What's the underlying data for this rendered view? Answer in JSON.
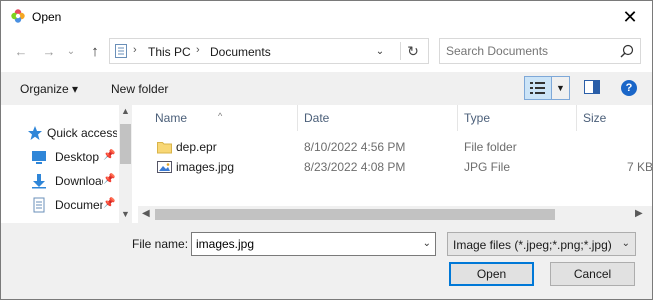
{
  "window": {
    "title": "Open",
    "close_glyph": "✕"
  },
  "nav": {
    "back_glyph": "←",
    "forward_glyph": "→",
    "recent_glyph": "⌄",
    "up_glyph": "↑"
  },
  "address": {
    "segments": [
      "This PC",
      "Documents"
    ],
    "chevron": "›",
    "refresh_glyph": "↻",
    "dropdown_glyph": "⌄"
  },
  "search": {
    "placeholder": "Search Documents"
  },
  "toolbar": {
    "organize_label": "Organize ▾",
    "new_folder_label": "New folder",
    "help_glyph": "?",
    "view_drop_glyph": "▼"
  },
  "sidebar": {
    "items": [
      {
        "label": "Quick access",
        "icon": "star-icon"
      },
      {
        "label": "Desktop",
        "icon": "desktop-icon",
        "pin": "📌"
      },
      {
        "label": "Downloads",
        "icon": "download-icon",
        "pin": "📌"
      },
      {
        "label": "Documents",
        "icon": "document-icon",
        "pin": "📌"
      }
    ],
    "scroll_up": "▲",
    "scroll_down": "▼"
  },
  "columns": {
    "name": "Name",
    "date": "Date",
    "type": "Type",
    "size": "Size",
    "sort_glyph": "^"
  },
  "files": [
    {
      "name": "dep.epr",
      "date": "8/10/2022 4:56 PM",
      "type": "File folder",
      "size": "",
      "icon": "folder-icon"
    },
    {
      "name": "images.jpg",
      "date": "8/23/2022 4:08 PM",
      "type": "JPG File",
      "size": "7 KB",
      "icon": "image-file-icon"
    }
  ],
  "hscroll": {
    "left": "◀",
    "right": "▶"
  },
  "bottom": {
    "file_name_label": "File name:",
    "file_name_value": "images.jpg",
    "dropdown_glyph": "⌄",
    "file_type_value": "Image files (*.jpeg;*.png;*.jpg)",
    "open_label": "Open",
    "cancel_label": "Cancel"
  },
  "colors": {
    "accent": "#0078d7",
    "toolbar_bg": "#f0f0f0",
    "header_text": "#4c607a",
    "help_blue": "#1a66c8"
  }
}
